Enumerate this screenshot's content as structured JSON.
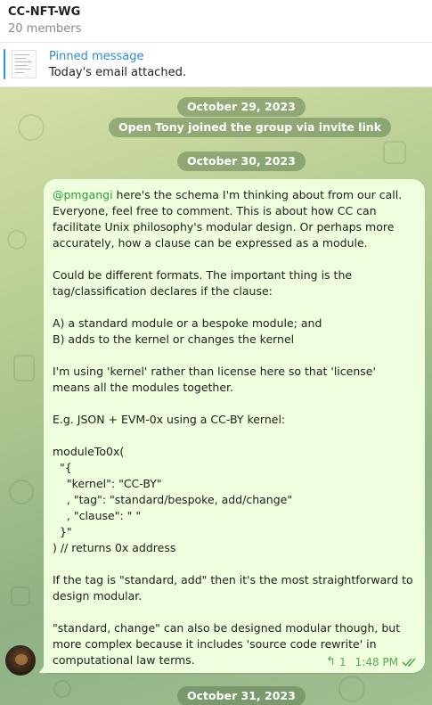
{
  "header": {
    "title": "CC-NFT-WG",
    "subtitle": "20 members"
  },
  "pinned": {
    "label": "Pinned message",
    "text": "Today's email attached."
  },
  "dates": [
    "October 29, 2023",
    "October 30, 2023",
    "October 31, 2023"
  ],
  "service": "Open Tony joined the group via invite link",
  "message": {
    "mention": "@pmgangi",
    "paragraphs": [
      " here's the schema I'm thinking about from our call. Everyone, feel free to comment. This is about how CC can facilitate Unix philosophy's modular design. Or perhaps more accurately, how a clause can be expressed as a module.",
      "Could be different formats. The important thing is the tag/classification declares if the clause:",
      "A) a standard module or a bespoke module; and\nB) adds to the kernel or changes the kernel",
      "I'm using 'kernel' rather than license here so that 'license' means all the modules together.",
      "E.g. JSON + EVM-0x using a CC-BY kernel:",
      "moduleTo0x(\n  \"{\n    \"kernel\": \"CC-BY\"\n    , \"tag\": \"standard/bespoke, add/change\"\n    , \"clause\": \" \"\n  }\"\n) // returns 0x address",
      "If the tag is \"standard, add\" then it's the most straightforward to design modular.",
      "\"standard, change\" can also be designed modular though, but more complex because it includes 'source code rewrite' in computational law terms."
    ],
    "reply_icon": "reply-arrow-icon",
    "reply_count": "1",
    "time": "1:48 PM",
    "status_icon": "double-check-icon"
  },
  "colors": {
    "accent": "#3390ec",
    "bubble": "#efffde",
    "meta": "#4fae4e",
    "mention": "#2b9c3b"
  }
}
